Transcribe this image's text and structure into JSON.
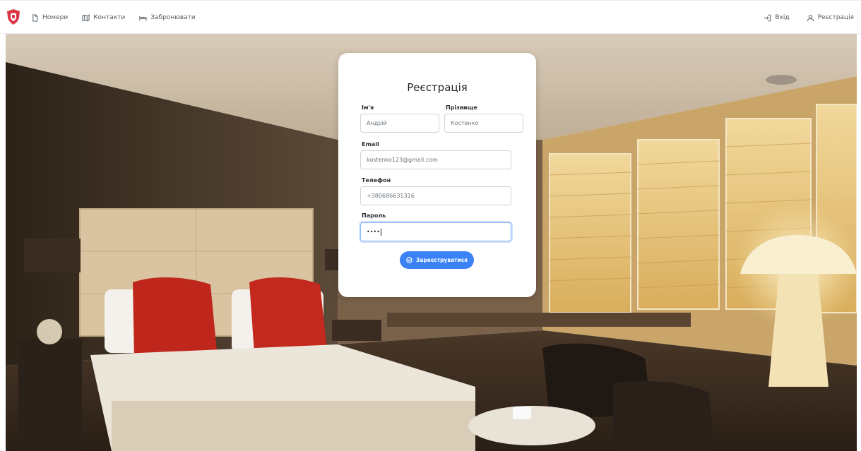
{
  "nav": {
    "brand_icon": "shield-logo-icon",
    "left_links": [
      {
        "label": "Номери",
        "icon": "file-icon"
      },
      {
        "label": "Контакти",
        "icon": "map-icon"
      },
      {
        "label": "Забронювати",
        "icon": "bed-icon"
      }
    ],
    "right_links": [
      {
        "label": "Вхід",
        "icon": "login-icon"
      },
      {
        "label": "Реєстрація",
        "icon": "user-icon"
      }
    ]
  },
  "form": {
    "title": "Реєстрація",
    "first_name": {
      "label": "Ім'я",
      "value": "Андрій"
    },
    "last_name": {
      "label": "Прізвище",
      "value": "Костенко"
    },
    "email": {
      "label": "Email",
      "value": "kostenko123@gmail.com"
    },
    "phone": {
      "label": "Телефон",
      "value": "+380686631316"
    },
    "password": {
      "label": "Пароль",
      "value": "••••"
    },
    "submit_label": "Зареєструватися",
    "submit_icon": "check-circle-icon"
  },
  "colors": {
    "brand": "#dc3545",
    "primary": "#3b82f6",
    "focus_border": "#86b7fe"
  }
}
